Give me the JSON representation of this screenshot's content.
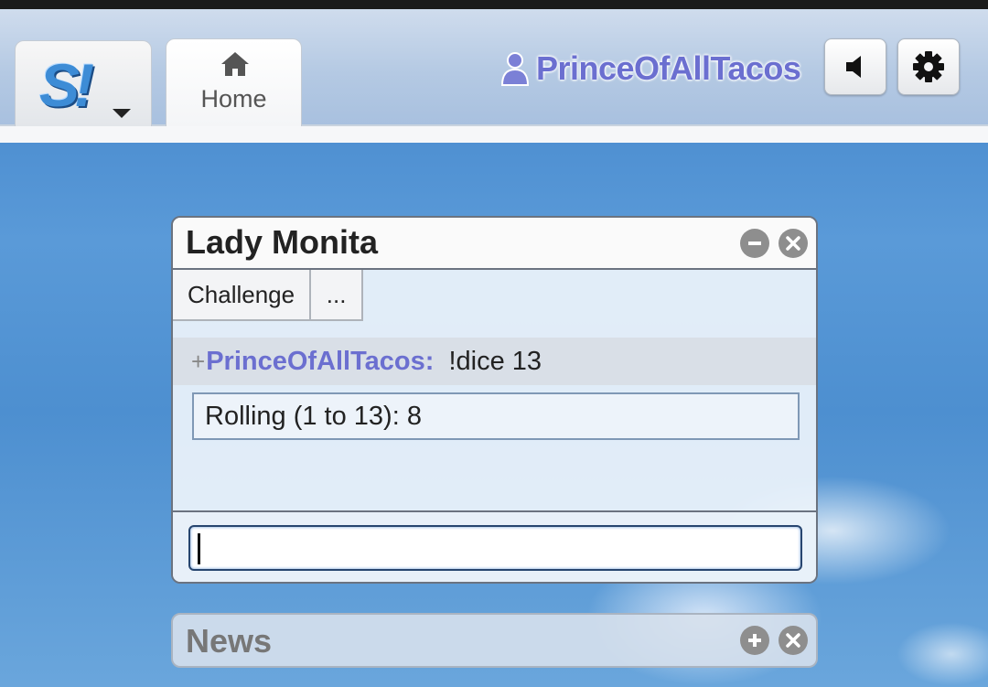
{
  "header": {
    "logo_alt": "S!",
    "home_label": "Home",
    "username": "PrinceOfAllTacos"
  },
  "chat": {
    "title": "Lady Monita",
    "actions": [
      "Challenge",
      "..."
    ],
    "message": {
      "prefix": "+",
      "user": "PrinceOfAllTacos:",
      "text": "!dice 13"
    },
    "result": "Rolling (1 to 13): 8",
    "input_value": ""
  },
  "news": {
    "title": "News"
  },
  "colors": {
    "username": "#6b6fd0",
    "accent_border": "#27456f"
  }
}
